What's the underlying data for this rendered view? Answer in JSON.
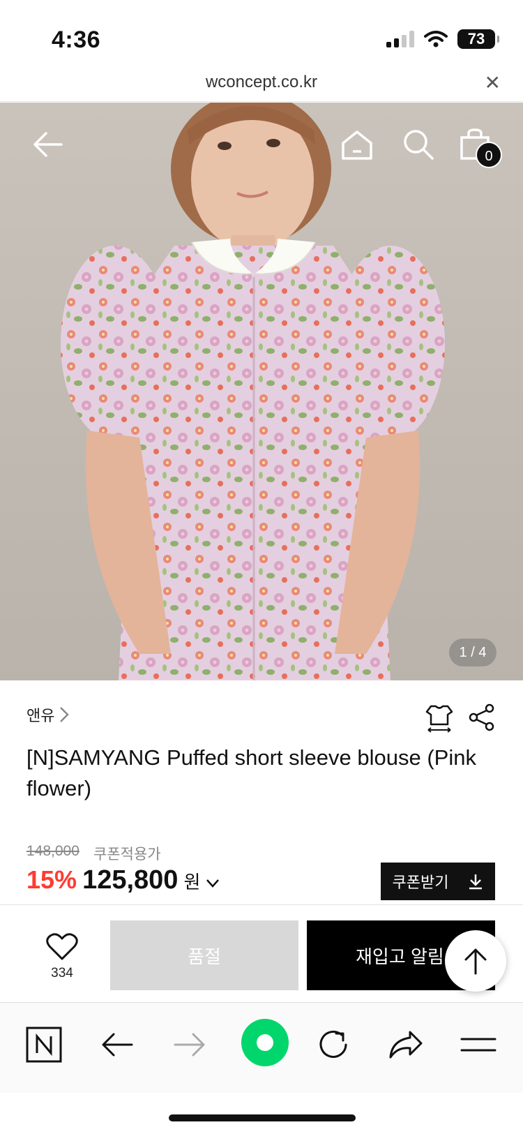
{
  "status_bar": {
    "time": "4:36",
    "battery": "73"
  },
  "browser": {
    "url": "wconcept.co.kr",
    "close_icon": "close-icon"
  },
  "image_header": {
    "back_icon": "arrow-left-icon",
    "home_icon": "home-icon",
    "search_icon": "search-icon",
    "cart_icon": "shopping-bag-icon",
    "cart_count": "0"
  },
  "gallery": {
    "page_indicator": "1 / 4"
  },
  "product": {
    "brand": "앤유",
    "name": "[N]SAMYANG Puffed short sleeve blouse (Pink flower)",
    "original_price": "148,000",
    "price_note": "쿠폰적용가",
    "discount": "15%",
    "price": "125,800",
    "currency": "원",
    "coupon_label": "쿠폰받기"
  },
  "actions": {
    "like_count": "334",
    "soldout_label": "품절",
    "restock_label": "재입고 알림"
  },
  "colors": {
    "discount": "#ff3b30",
    "accent_green": "#00d66b"
  }
}
